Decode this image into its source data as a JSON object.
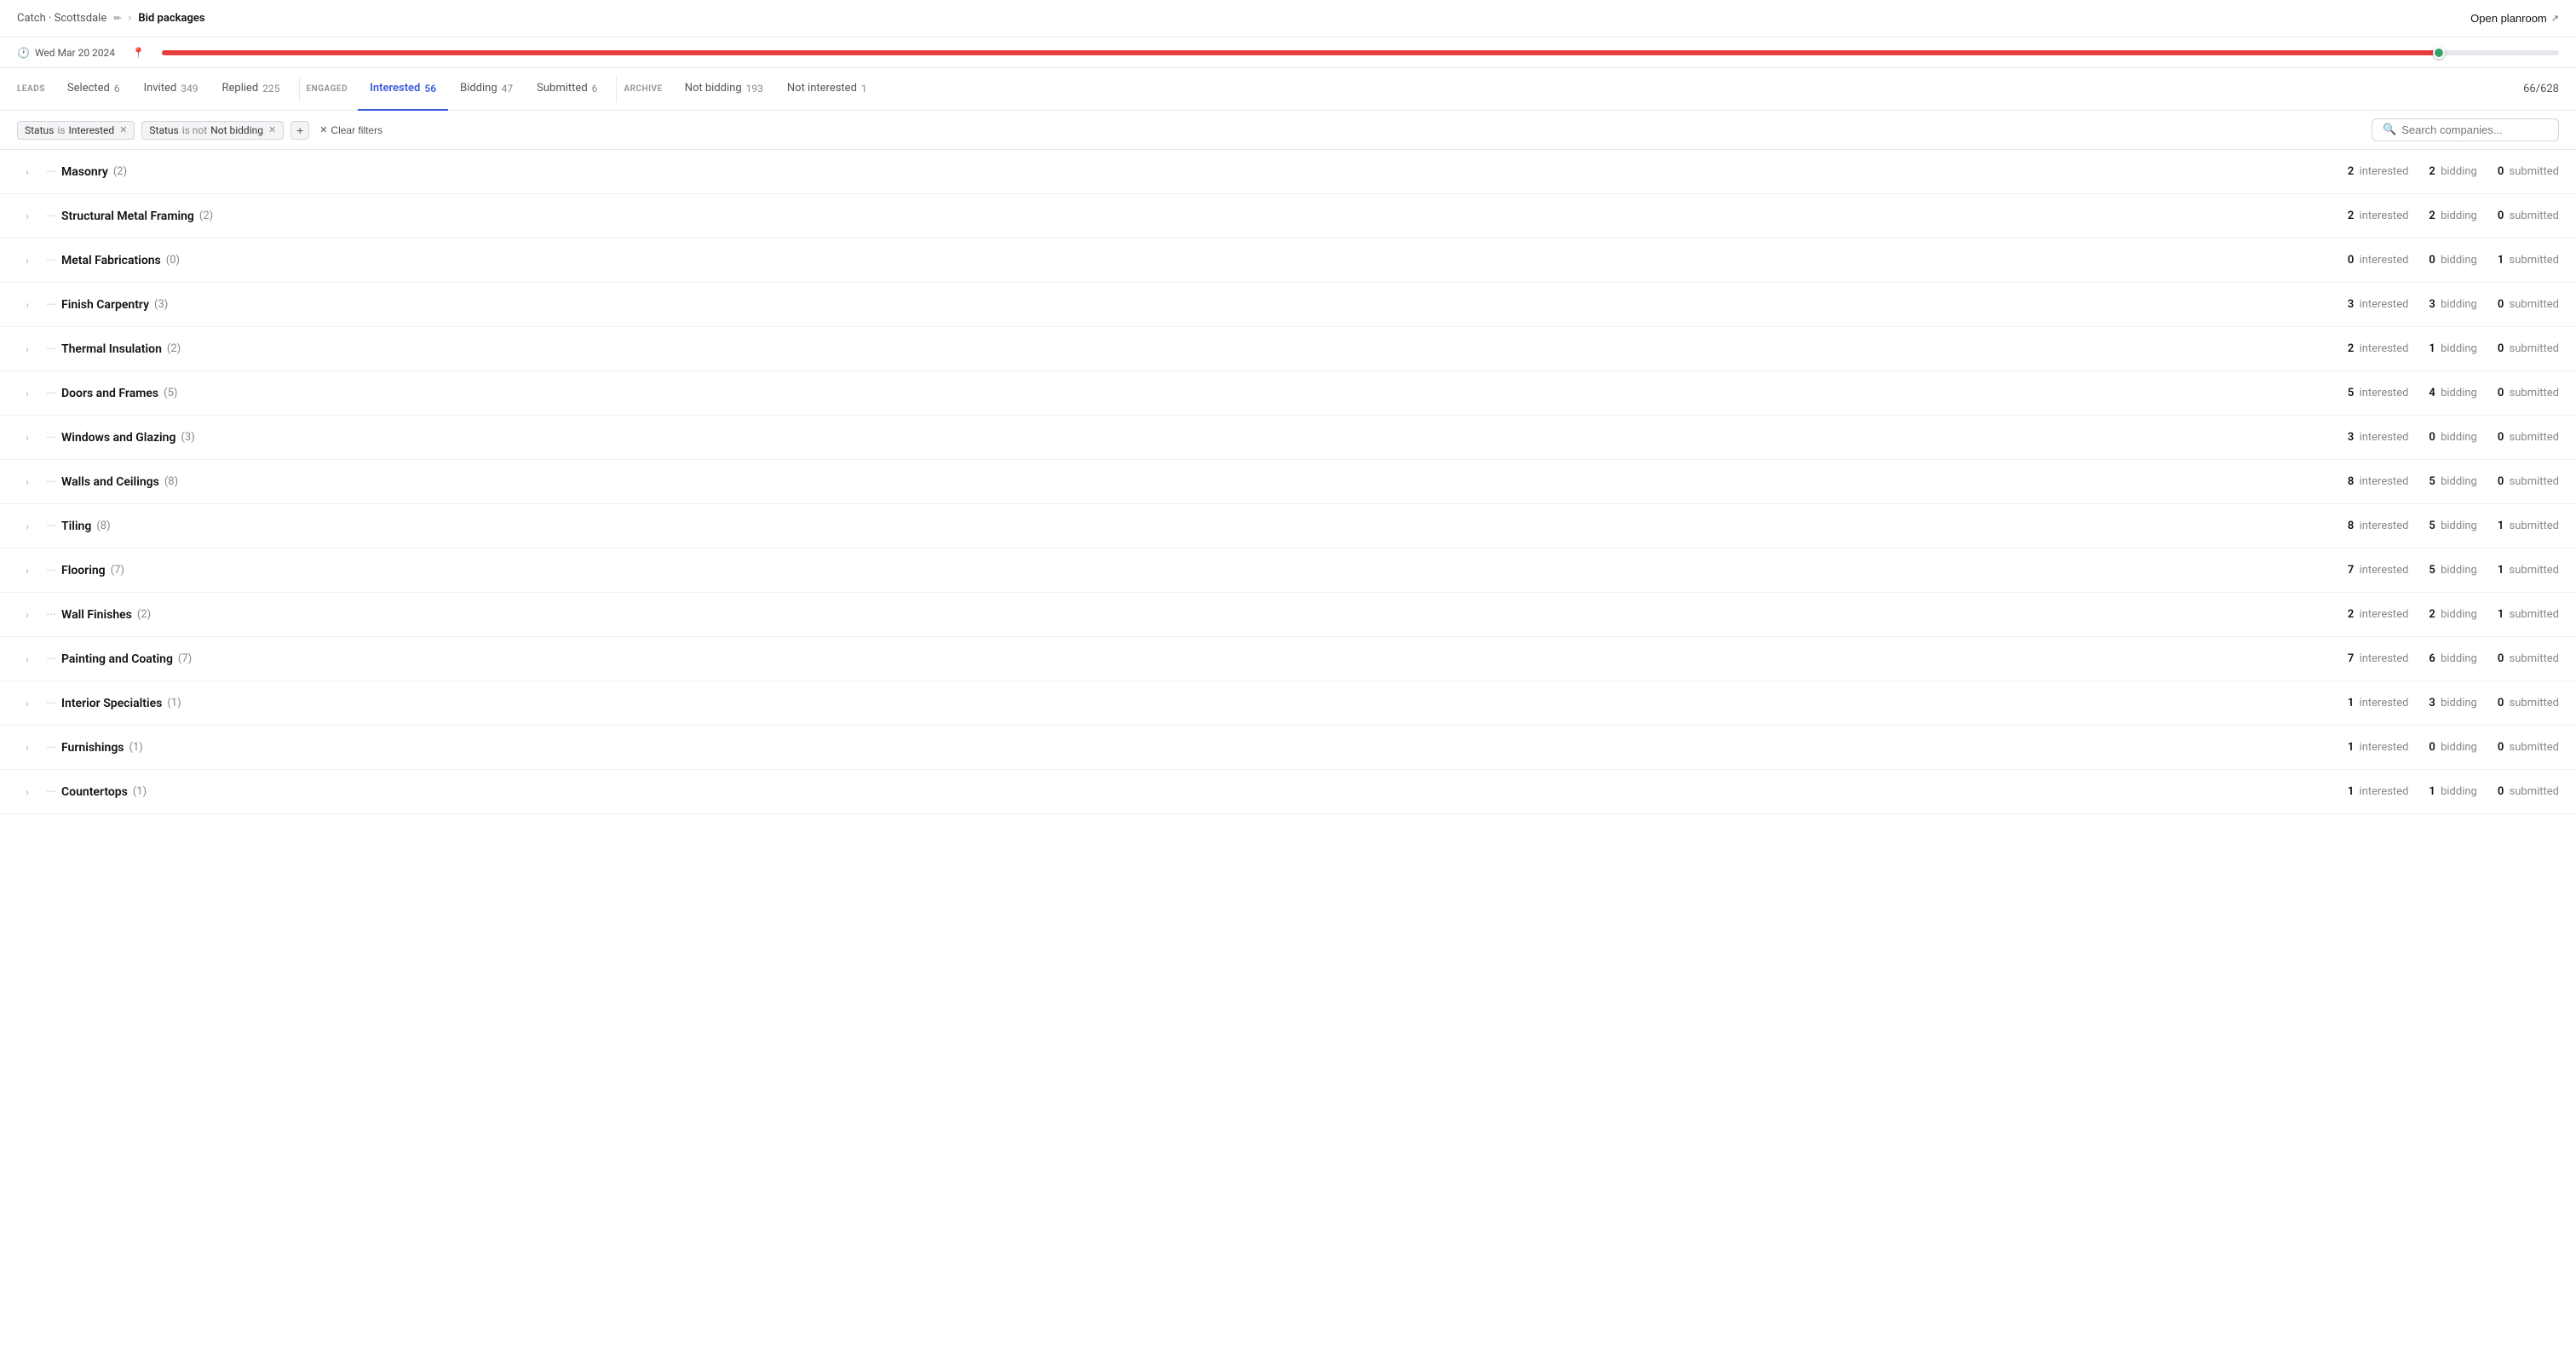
{
  "topbar": {
    "prefix": "Catch · Scottsdale",
    "separator": "›",
    "title": "Bid packages",
    "edit_icon": "✏",
    "open_planroom": "Open planroom",
    "external_icon": "↗"
  },
  "subbar": {
    "date_icon": "🕐",
    "date": "Wed Mar 20 2024",
    "location_icon": "📍",
    "progress_percent": 95
  },
  "tabs": {
    "leads_label": "LEADS",
    "leads_tabs": [
      {
        "id": "selected",
        "label": "Selected",
        "badge": "6"
      },
      {
        "id": "invited",
        "label": "Invited",
        "badge": "349"
      },
      {
        "id": "replied",
        "label": "Replied",
        "badge": "225"
      }
    ],
    "engaged_label": "ENGAGED",
    "engaged_tabs": [
      {
        "id": "interested",
        "label": "Interested",
        "badge": "56",
        "active": true
      },
      {
        "id": "bidding",
        "label": "Bidding",
        "badge": "47"
      },
      {
        "id": "submitted",
        "label": "Submitted",
        "badge": "6"
      }
    ],
    "archive_label": "ARCHIVE",
    "archive_tabs": [
      {
        "id": "not-bidding",
        "label": "Not bidding",
        "badge": "193"
      },
      {
        "id": "not-interested",
        "label": "Not interested",
        "badge": "1"
      }
    ],
    "count_display": "66/628"
  },
  "filters": {
    "filter1_label": "Status",
    "filter1_op": "is",
    "filter1_value": "Interested",
    "filter2_label": "Status",
    "filter2_op": "is not",
    "filter2_value": "Not bidding",
    "add_label": "+",
    "clear_label": "Clear filters",
    "search_placeholder": "Search companies..."
  },
  "rows": [
    {
      "name": "Masonry",
      "count": 2,
      "interested": 2,
      "bidding": 2,
      "submitted": 0
    },
    {
      "name": "Structural Metal Framing",
      "count": 2,
      "interested": 2,
      "bidding": 2,
      "submitted": 0
    },
    {
      "name": "Metal Fabrications",
      "count": 0,
      "interested": 0,
      "bidding": 0,
      "submitted": 1
    },
    {
      "name": "Finish Carpentry",
      "count": 3,
      "interested": 3,
      "bidding": 3,
      "submitted": 0
    },
    {
      "name": "Thermal Insulation",
      "count": 2,
      "interested": 2,
      "bidding": 1,
      "submitted": 0
    },
    {
      "name": "Doors and Frames",
      "count": 5,
      "interested": 5,
      "bidding": 4,
      "submitted": 0
    },
    {
      "name": "Windows and Glazing",
      "count": 3,
      "interested": 3,
      "bidding": 0,
      "submitted": 0
    },
    {
      "name": "Walls and Ceilings",
      "count": 8,
      "interested": 8,
      "bidding": 5,
      "submitted": 0
    },
    {
      "name": "Tiling",
      "count": 8,
      "interested": 8,
      "bidding": 5,
      "submitted": 1
    },
    {
      "name": "Flooring",
      "count": 7,
      "interested": 7,
      "bidding": 5,
      "submitted": 1
    },
    {
      "name": "Wall Finishes",
      "count": 2,
      "interested": 2,
      "bidding": 2,
      "submitted": 1
    },
    {
      "name": "Painting and Coating",
      "count": 7,
      "interested": 7,
      "bidding": 6,
      "submitted": 0
    },
    {
      "name": "Interior Specialties",
      "count": 1,
      "interested": 1,
      "bidding": 3,
      "submitted": 0
    },
    {
      "name": "Furnishings",
      "count": 1,
      "interested": 1,
      "bidding": 0,
      "submitted": 0
    },
    {
      "name": "Countertops",
      "count": 1,
      "interested": 1,
      "bidding": 1,
      "submitted": 0
    }
  ]
}
